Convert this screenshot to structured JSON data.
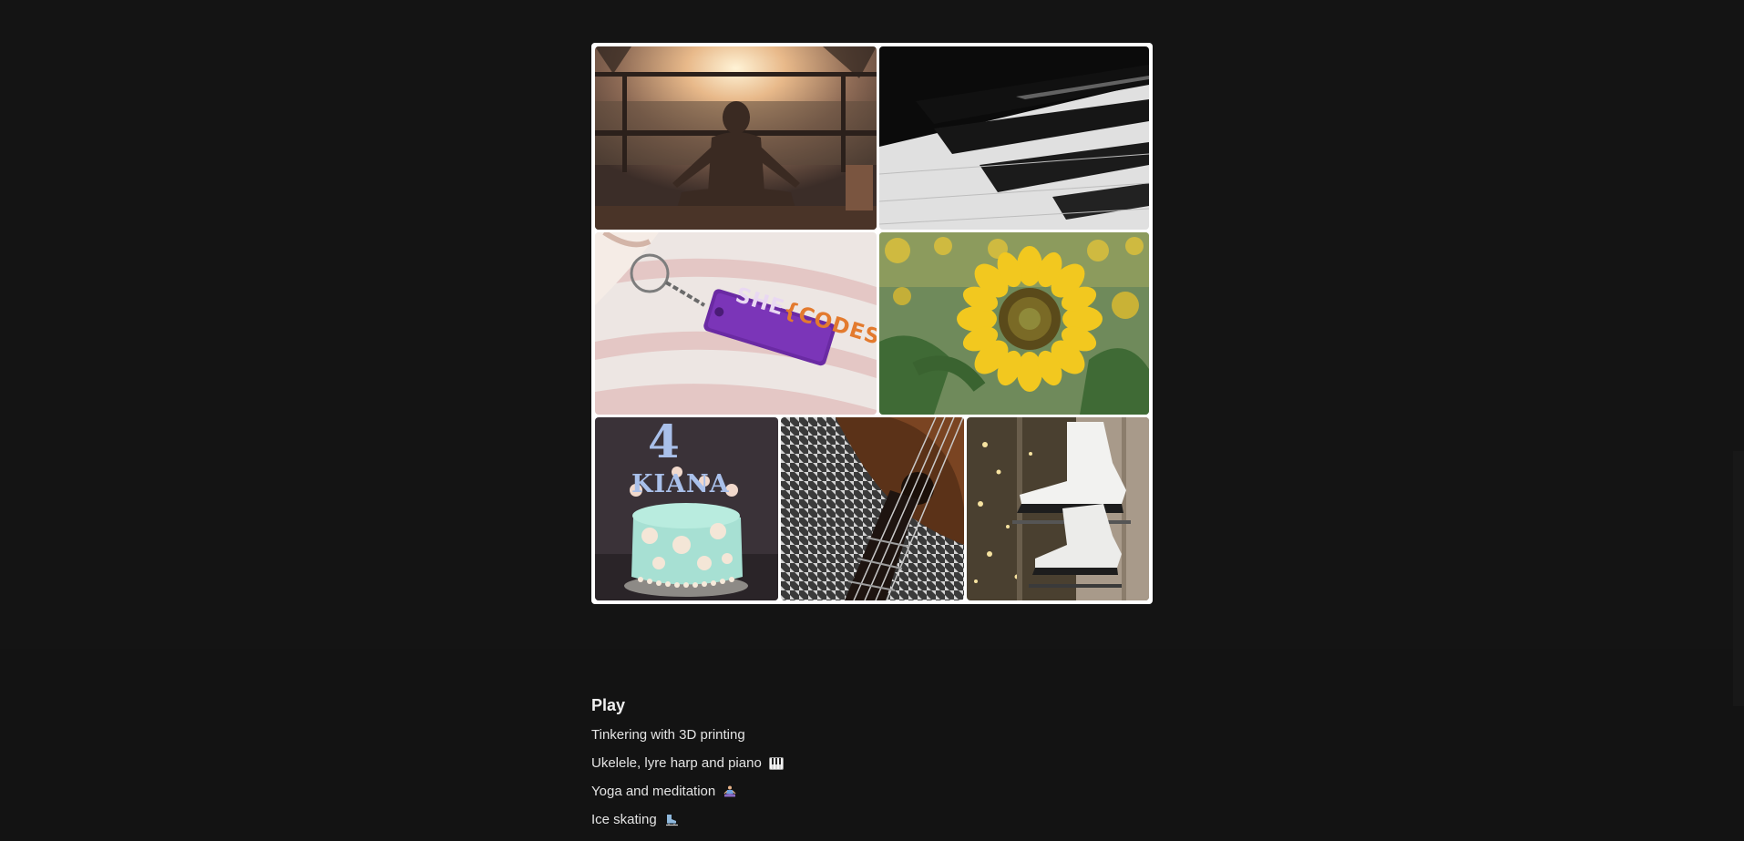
{
  "gallery": {
    "tiles": [
      {
        "name": "yoga-photo"
      },
      {
        "name": "piano-keys-photo"
      },
      {
        "name": "keychain-photo",
        "keychain_left": "SHE",
        "keychain_right": "{CODES}"
      },
      {
        "name": "sunflower-photo"
      },
      {
        "name": "cake-photo",
        "cake_number": "4",
        "cake_name": "KIANA"
      },
      {
        "name": "ukulele-photo"
      },
      {
        "name": "ice-skates-photo"
      }
    ]
  },
  "play": {
    "heading": "Play",
    "items": [
      {
        "label": "Tinkering with 3D printing",
        "icon": ""
      },
      {
        "label": "Ukelele, lyre harp and piano",
        "icon": "piano-icon"
      },
      {
        "label": "Yoga and meditation",
        "icon": "meditation-icon"
      },
      {
        "label": "Ice skating",
        "icon": "ice-skate-icon"
      }
    ]
  },
  "colors": {
    "background": "#141414",
    "text": "#e4e4e4",
    "gallery_frame": "#ffffff"
  }
}
